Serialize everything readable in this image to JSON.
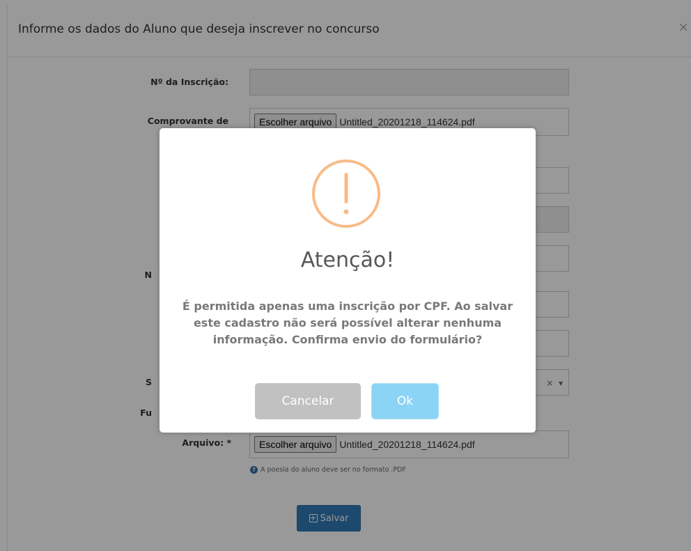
{
  "modal": {
    "title": "Informe os dados do Aluno que deseja inscrever no concurso",
    "close_symbol": "×"
  },
  "form": {
    "inscricao_label": "Nº da Inscrição:",
    "inscricao_value": "",
    "comprovante_label": "Comprovante de",
    "comprovante_button": "Escolher arquivo",
    "comprovante_file": "Untitled_20201218_114624.pdf",
    "partial_label_n": "N",
    "partial_label_s": "S",
    "partial_label_fu": "Fu",
    "arquivo_label": "Arquivo: *",
    "arquivo_button": "Escolher arquivo",
    "arquivo_file": "Untitled_20201218_114624.pdf",
    "select_clear": "×",
    "select_arrow": "▾",
    "help_icon": "?",
    "help_text": "A poesia do aluno deve ser no formato .PDF",
    "save_label": "Salvar"
  },
  "alert": {
    "icon": "warning-exclamation-icon",
    "icon_color": "#f8bb86",
    "title": "Atenção!",
    "message": "É permitida apenas uma inscrição por CPF. Ao salvar este cadastro não será possível alterar nenhuma informação. Confirma envio do formulário?",
    "cancel_label": "Cancelar",
    "ok_label": "Ok",
    "cancel_color": "#c1c1c1",
    "ok_color": "#8cd4f5"
  }
}
